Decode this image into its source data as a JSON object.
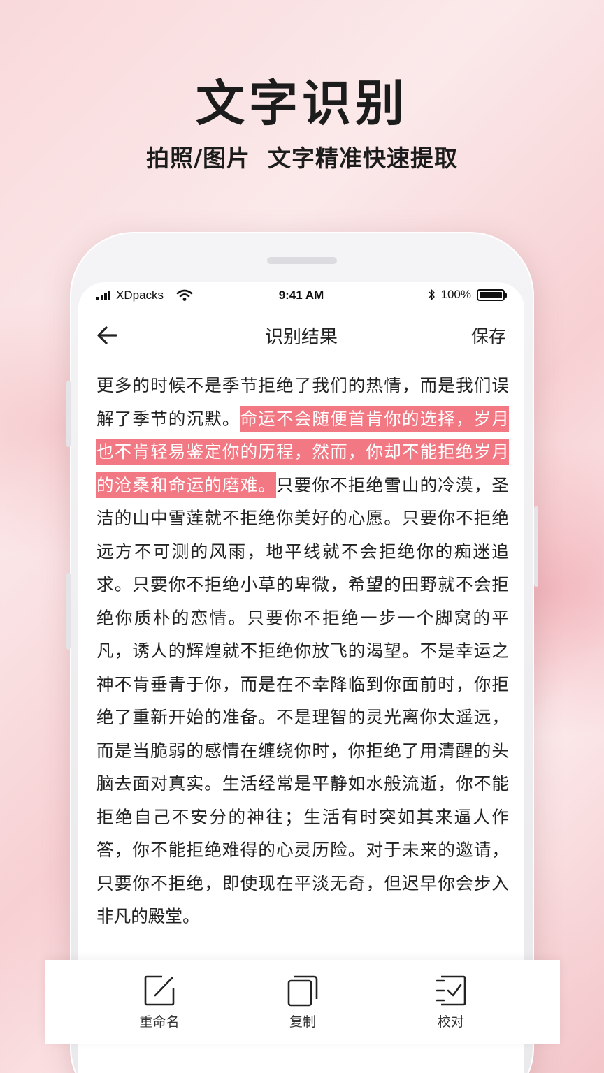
{
  "promo": {
    "title": "文字识别",
    "subtitle": "拍照/图片  文字精准快速提取"
  },
  "status_bar": {
    "carrier": "XDpacks",
    "time": "9:41 AM",
    "battery": "100%"
  },
  "nav": {
    "title": "识别结果",
    "save_label": "保存"
  },
  "content": {
    "before_highlight": "更多的时候不是季节拒绝了我们的热情，而是我们误解了季节的沉默。",
    "highlight": "命运不会随便首肯你的选择，岁月也不肯轻易鉴定你的历程，然而，你却不能拒绝岁月的沧桑和命运的磨难。",
    "after_highlight": "只要你不拒绝雪山的冷漠，圣洁的山中雪莲就不拒绝你美好的心愿。只要你不拒绝远方不可测的风雨，地平线就不会拒绝你的痴迷追求。只要你不拒绝小草的卑微，希望的田野就不会拒绝你质朴的恋情。只要你不拒绝一步一个脚窝的平凡，诱人的辉煌就不拒绝你放飞的渴望。不是幸运之神不肯垂青于你，而是在不幸降临到你面前时，你拒绝了重新开始的准备。不是理智的灵光离你太遥远，而是当脆弱的感情在缠绕你时，你拒绝了用清醒的头脑去面对真实。生活经常是平静如水般流逝，你不能拒绝自己不安分的神往；生活有时突如其来逼人作答，你不能拒绝难得的心灵历险。对于未来的邀请，只要你不拒绝，即使现在平淡无奇，但迟早你会步入非凡的殿堂。",
    "highlight_color": "#f27983"
  },
  "toolbar": {
    "rename_label": "重命名",
    "copy_label": "复制",
    "proofread_label": "校对"
  }
}
